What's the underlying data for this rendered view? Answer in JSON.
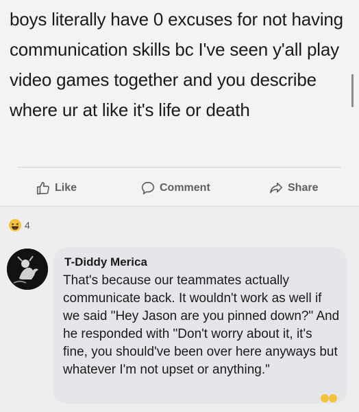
{
  "post": {
    "text": "boys literally have 0 excuses for not having communication skills bc I've seen y'all play video games together and you describe where ur at like it's life or death"
  },
  "actions": {
    "like_label": "Like",
    "comment_label": "Comment",
    "share_label": "Share"
  },
  "reactions": {
    "icon": "haha-emoji-icon",
    "count": "4"
  },
  "comment": {
    "author": "T-Diddy Merica",
    "text": "That's because our teammates actually communicate back. It wouldn't work as well if we said \"Hey Jason are you pinned down?\" And he responded with \"Don't worry about it, it's fine, you should've been over here anyways but whatever I'm not upset or anything.\""
  },
  "colors": {
    "post_background": "#f3f3f3",
    "comment_bubble": "#e6e6ea",
    "action_text": "#5f5f5f",
    "text": "#1a1a1a"
  }
}
